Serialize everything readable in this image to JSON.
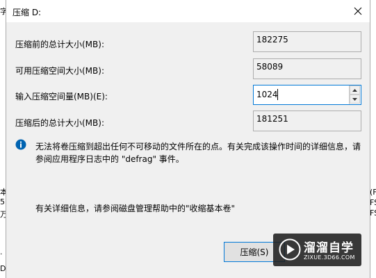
{
  "background": {
    "left_chars": [
      "字",
      "本",
      "5.",
      "万",
      "."
    ],
    "left_bottom": "D",
    "right_chars": [
      "(F",
      "FS",
      "FS"
    ]
  },
  "dialog": {
    "title": "压缩 D:",
    "fields": {
      "total_before_label": "压缩前的总计大小(MB):",
      "total_before_value": "182275",
      "available_label": "可用压缩空间大小(MB):",
      "available_value": "58089",
      "amount_label": "输入压缩空间量(MB)(E):",
      "amount_value": "1024",
      "total_after_label": "压缩后的总计大小(MB):",
      "total_after_value": "181251"
    },
    "info_text": "无法将卷压缩到超出任何不可移动的文件所在的点。有关完成该操作时间的详细信息，请参阅应用程序日志中的 \"defrag\" 事件。",
    "help_text": "有关详细信息，请参阅磁盘管理帮助中的\"收缩基本卷\"",
    "compress_button": "压缩(S)"
  },
  "watermark": {
    "name": "溜溜自学",
    "url": "ZIXUE.3D66.COM"
  },
  "colors": {
    "accent": "#0078d7",
    "info_icon": "#0063b1"
  }
}
